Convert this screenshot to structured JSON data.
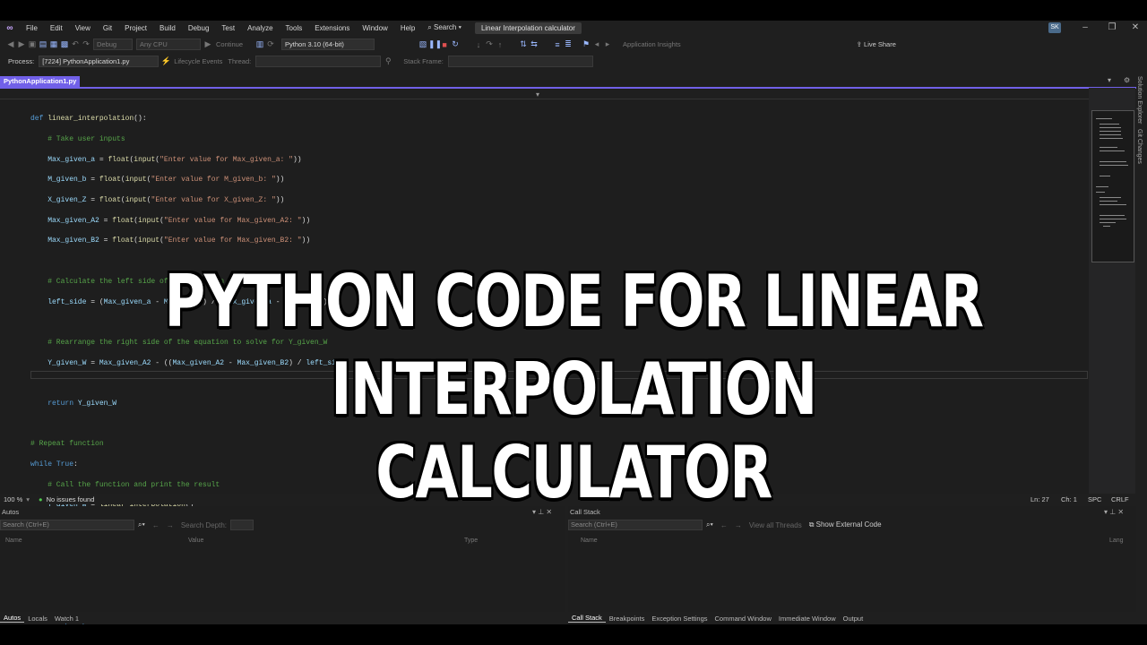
{
  "menu": {
    "items": [
      "File",
      "Edit",
      "View",
      "Git",
      "Project",
      "Build",
      "Debug",
      "Test",
      "Analyze",
      "Tools",
      "Extensions",
      "Window",
      "Help"
    ],
    "search": "Search",
    "solution_title": "Linear Interpolation calculator",
    "avatar": "SK"
  },
  "toolbar": {
    "config": "Debug",
    "platform": "Any CPU",
    "continue_label": "Continue",
    "python_env": "Python 3.10 (64-bit)",
    "insights": "Application Insights",
    "live_share": "Live Share"
  },
  "process_bar": {
    "process_label": "Process:",
    "process_value": "[7224] PythonApplication1.py",
    "lifecycle": "Lifecycle Events",
    "thread": "Thread:",
    "stack_frame": "Stack Frame:"
  },
  "editor": {
    "tab": "PythonApplication1.py"
  },
  "side_tabs": [
    "Solution Explorer",
    "Git Changes"
  ],
  "status": {
    "zoom": "100 %",
    "issues": "No issues found",
    "line": "Ln: 27",
    "col": "Ch: 1",
    "spc": "SPC",
    "crlf": "CRLF"
  },
  "autos": {
    "title": "Autos",
    "search": "Search (Ctrl+E)",
    "depth": "Search Depth:",
    "cols": [
      "Name",
      "Value",
      "Type"
    ],
    "tabs": [
      "Autos",
      "Locals",
      "Watch 1"
    ]
  },
  "callstack": {
    "title": "Call Stack",
    "search": "Search (Ctrl+E)",
    "view_threads": "View all Threads",
    "external": "Show External Code",
    "cols": [
      "Name",
      "Lang"
    ],
    "tabs": [
      "Call Stack",
      "Breakpoints",
      "Exception Settings",
      "Command Window",
      "Immediate Window",
      "Output"
    ]
  },
  "overlay": {
    "line1": "PYTHON CODE FOR LINEAR",
    "line2": "INTERPOLATION CALCULATOR"
  },
  "colors": {
    "accent": "#7160e8",
    "background": "#1e1e1e"
  }
}
